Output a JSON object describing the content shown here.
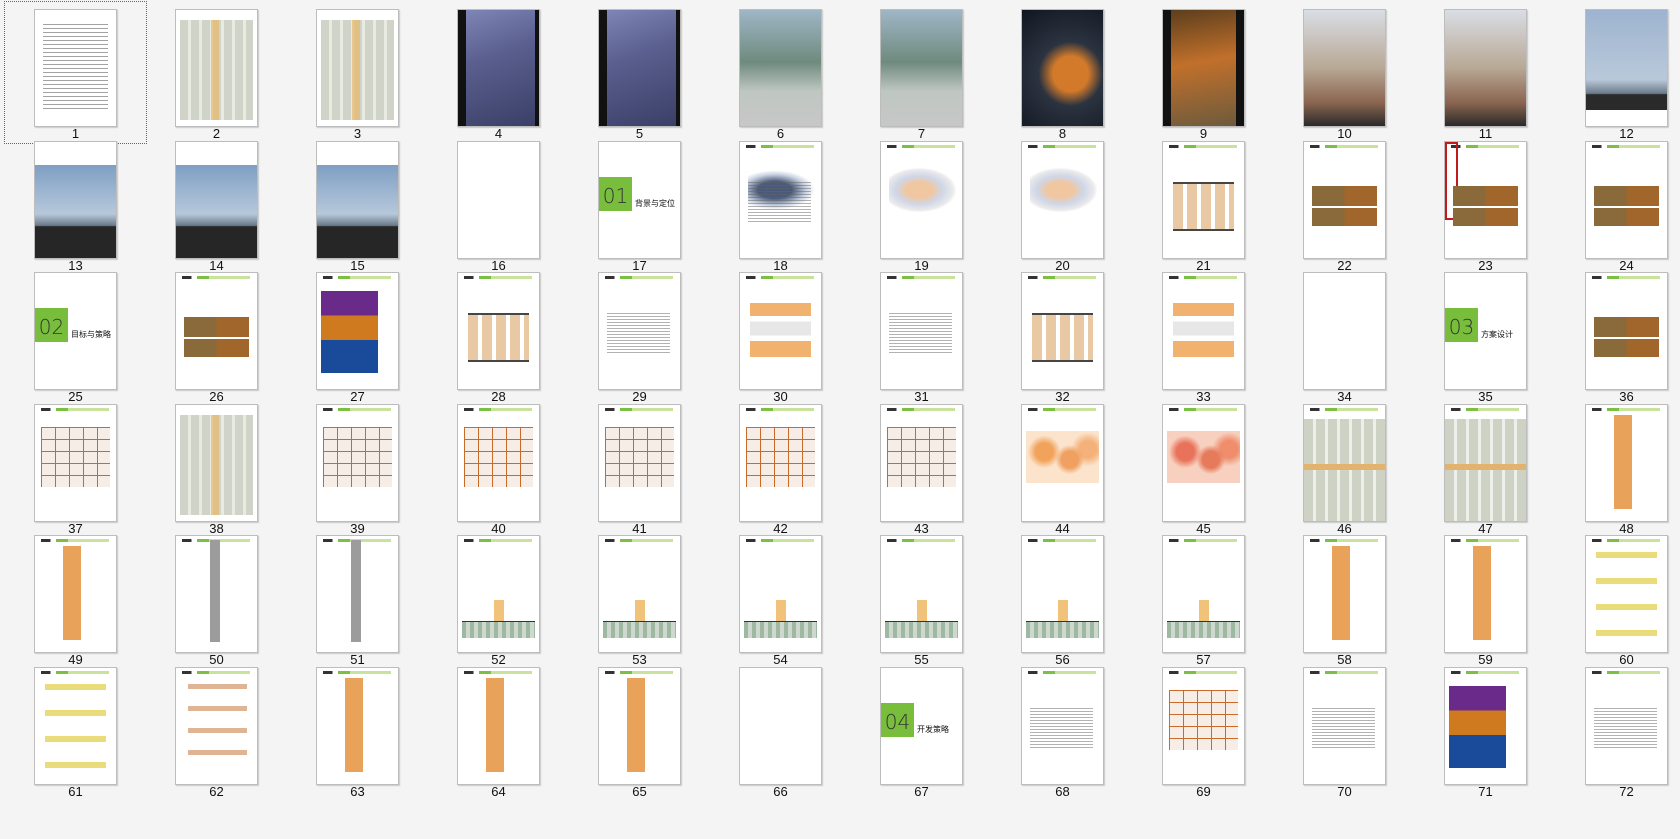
{
  "pages": [
    {
      "n": "1",
      "kind": "doc-lines"
    },
    {
      "n": "2",
      "kind": "map"
    },
    {
      "n": "3",
      "kind": "map"
    },
    {
      "n": "4",
      "kind": "photo-blue"
    },
    {
      "n": "5",
      "kind": "photo-blue"
    },
    {
      "n": "6",
      "kind": "photo-street"
    },
    {
      "n": "7",
      "kind": "photo-street"
    },
    {
      "n": "8",
      "kind": "photo-dark"
    },
    {
      "n": "9",
      "kind": "photo-orange"
    },
    {
      "n": "10",
      "kind": "photo-building"
    },
    {
      "n": "11",
      "kind": "photo-building"
    },
    {
      "n": "12",
      "kind": "skyline"
    },
    {
      "n": "13",
      "kind": "skyline2"
    },
    {
      "n": "14",
      "kind": "skyline2"
    },
    {
      "n": "15",
      "kind": "skyline2"
    },
    {
      "n": "16",
      "kind": "blank"
    },
    {
      "n": "17",
      "kind": "section",
      "num": "01",
      "title": "背景与定位"
    },
    {
      "n": "18",
      "kind": "mapcolor"
    },
    {
      "n": "19",
      "kind": "palemap"
    },
    {
      "n": "20",
      "kind": "palemap"
    },
    {
      "n": "21",
      "kind": "diagram"
    },
    {
      "n": "22",
      "kind": "photos"
    },
    {
      "n": "23",
      "kind": "redbox"
    },
    {
      "n": "24",
      "kind": "photos"
    },
    {
      "n": "25",
      "kind": "section",
      "num": "02",
      "title": "目标与策略"
    },
    {
      "n": "26",
      "kind": "photos"
    },
    {
      "n": "27",
      "kind": "nightphoto"
    },
    {
      "n": "28",
      "kind": "diagram"
    },
    {
      "n": "29",
      "kind": "text"
    },
    {
      "n": "30",
      "kind": "graydiagram"
    },
    {
      "n": "31",
      "kind": "text"
    },
    {
      "n": "32",
      "kind": "diagram"
    },
    {
      "n": "33",
      "kind": "graydiagram"
    },
    {
      "n": "34",
      "kind": "blank"
    },
    {
      "n": "35",
      "kind": "section",
      "num": "03",
      "title": "方案设计"
    },
    {
      "n": "36",
      "kind": "photos"
    },
    {
      "n": "37",
      "kind": "orangegrid"
    },
    {
      "n": "38",
      "kind": "map"
    },
    {
      "n": "39",
      "kind": "orangegrid"
    },
    {
      "n": "40",
      "kind": "orangegrid"
    },
    {
      "n": "41",
      "kind": "orangegrid"
    },
    {
      "n": "42",
      "kind": "orangegrid"
    },
    {
      "n": "43",
      "kind": "orangegrid"
    },
    {
      "n": "44",
      "kind": "blobs"
    },
    {
      "n": "45",
      "kind": "blobsred"
    },
    {
      "n": "46",
      "kind": "plan"
    },
    {
      "n": "47",
      "kind": "plan"
    },
    {
      "n": "48",
      "kind": "orangestack"
    },
    {
      "n": "49",
      "kind": "orangestack"
    },
    {
      "n": "50",
      "kind": "vertical"
    },
    {
      "n": "51",
      "kind": "vertical"
    },
    {
      "n": "52",
      "kind": "section-draw"
    },
    {
      "n": "53",
      "kind": "section-draw"
    },
    {
      "n": "54",
      "kind": "section-draw"
    },
    {
      "n": "55",
      "kind": "section-draw"
    },
    {
      "n": "56",
      "kind": "section-draw"
    },
    {
      "n": "57",
      "kind": "section-draw"
    },
    {
      "n": "58",
      "kind": "orangestack"
    },
    {
      "n": "59",
      "kind": "orangestack"
    },
    {
      "n": "60",
      "kind": "iso"
    },
    {
      "n": "61",
      "kind": "iso"
    },
    {
      "n": "62",
      "kind": "iso2"
    },
    {
      "n": "63",
      "kind": "orangestack"
    },
    {
      "n": "64",
      "kind": "orangestack"
    },
    {
      "n": "65",
      "kind": "orangestack"
    },
    {
      "n": "66",
      "kind": "blank"
    },
    {
      "n": "67",
      "kind": "section",
      "num": "04",
      "title": "开发策略"
    },
    {
      "n": "68",
      "kind": "text"
    },
    {
      "n": "69",
      "kind": "orangegrid"
    },
    {
      "n": "70",
      "kind": "text"
    },
    {
      "n": "71",
      "kind": "nightphoto"
    },
    {
      "n": "72",
      "kind": "text"
    }
  ],
  "selected_page": "1"
}
